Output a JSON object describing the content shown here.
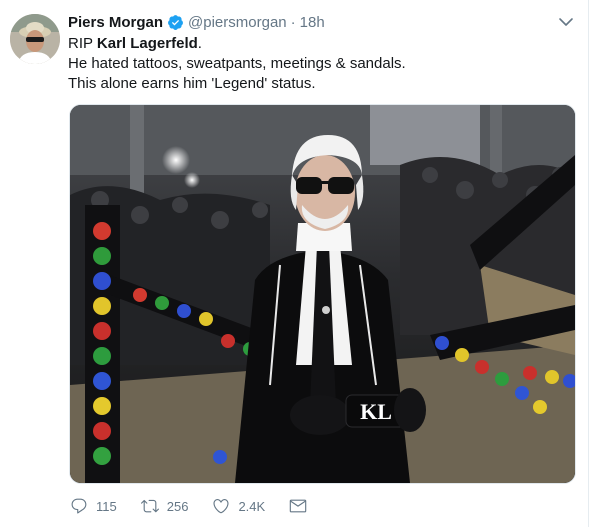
{
  "tweet": {
    "author_name": "Piers Morgan",
    "handle": "@piersmorgan",
    "separator": "·",
    "timestamp": "18h",
    "text": {
      "line1_prefix": "RIP ",
      "line1_bold": "Karl Lagerfeld",
      "line1_suffix": ".",
      "line2": "He hated tattoos, sweatpants, meetings & sandals.",
      "line3": "This alone earns him 'Legend' status."
    },
    "media": {
      "bag_monogram": "KL"
    },
    "actions": {
      "replies": "115",
      "retweets": "256",
      "likes": "2.4K"
    }
  },
  "colors": {
    "verified_blue": "#1da1f2",
    "text_primary": "#14171a",
    "text_secondary": "#657786"
  },
  "icons": [
    "verified-badge-icon",
    "chevron-down-icon",
    "reply-icon",
    "retweet-icon",
    "like-icon",
    "direct-message-icon"
  ]
}
